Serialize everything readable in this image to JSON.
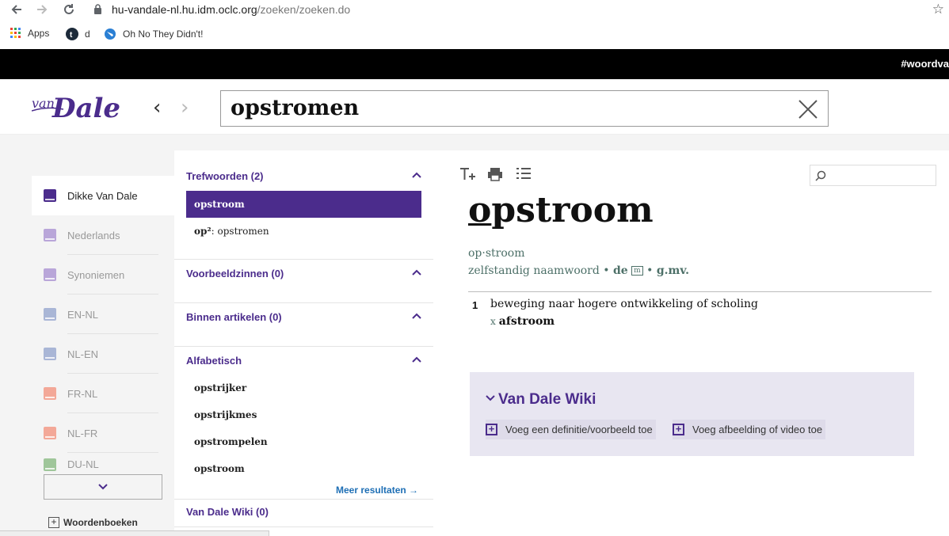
{
  "browser": {
    "url_host": "hu-vandale-nl.hu.idm.oclc.org",
    "url_path": "/zoeken/zoeken.do",
    "bookmarks": [
      {
        "label": "Apps",
        "icon": "apps-grid-icon"
      },
      {
        "label": "d",
        "icon": "tumblr-icon"
      },
      {
        "label": "Oh No They Didn't!",
        "icon": "livejournal-icon"
      }
    ]
  },
  "banner": {
    "hashtag": "#woordva"
  },
  "header": {
    "logo_small": "van",
    "logo_big": "Dale",
    "search_value": "opstromen"
  },
  "dictionaries": {
    "items": [
      {
        "label": "Dikke Van Dale",
        "color": "#4b2c8c"
      },
      {
        "label": "Nederlands",
        "color": "#b9a6d9"
      },
      {
        "label": "Synoniemen",
        "color": "#b9a6d9"
      },
      {
        "label": "EN-NL",
        "color": "#a9b6d6"
      },
      {
        "label": "NL-EN",
        "color": "#a9b6d6"
      },
      {
        "label": "FR-NL",
        "color": "#f3a898"
      },
      {
        "label": "NL-FR",
        "color": "#f3a898"
      },
      {
        "label": "DU-NL",
        "color": "#9fc69a"
      }
    ],
    "more_chevron": "⌄",
    "footer_label": "Woordenboeken"
  },
  "results": {
    "sections": [
      {
        "label": "Trefwoorden (2)"
      },
      {
        "label": "Voorbeeldzinnen (0)"
      },
      {
        "label": "Binnen artikelen (0)"
      },
      {
        "label": "Alfabetisch"
      },
      {
        "label": "Van Dale Wiki (0)"
      }
    ],
    "trefwoorden": [
      {
        "label": "opstroom"
      },
      {
        "label_bold": "op²",
        "label_rest": ": opstromen"
      }
    ],
    "alfabetisch": [
      {
        "label": "opstrijker"
      },
      {
        "label": "opstrijkmes"
      },
      {
        "label": "opstrompelen"
      },
      {
        "label": "opstroom"
      }
    ],
    "more_link": "Meer resultaten →"
  },
  "article": {
    "headword_first": "o",
    "headword_rest": "pstroom",
    "syllabification": "op·stroom",
    "pos": "zelfstandig naamwoord",
    "bullet": "•",
    "article_word": "de",
    "gender": "m",
    "plural": "g.mv.",
    "sense_number": "1",
    "sense_text": "beweging naar hogere ontwikkeling of scholing",
    "opposite_marker": "x",
    "opposite": "afstroom"
  },
  "wiki": {
    "title": "Van Dale Wiki",
    "chevron": "⌄",
    "add_definition": "Voeg een definitie/voorbeeld toe",
    "add_media": "Voeg afbeelding of video toe"
  }
}
